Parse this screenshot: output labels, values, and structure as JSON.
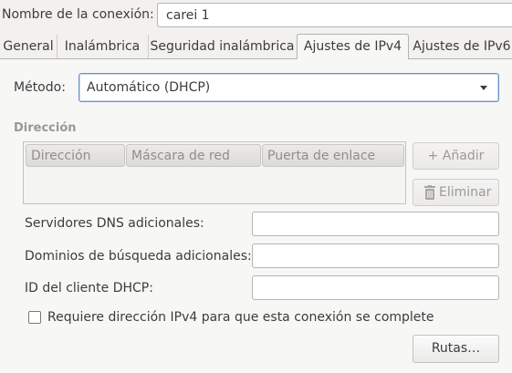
{
  "connection": {
    "name_label": "Nombre de la conexión:",
    "name_value": "carei 1"
  },
  "tabs": [
    {
      "label": "General"
    },
    {
      "label": "Inalámbrica"
    },
    {
      "label": "Seguridad inalámbrica"
    },
    {
      "label": "Ajustes de IPv4"
    },
    {
      "label": "Ajustes de IPv6"
    }
  ],
  "active_tab": "Ajustes de IPv4",
  "method": {
    "label": "Método:",
    "value": "Automático (DHCP)"
  },
  "address_section": {
    "title": "Dirección",
    "columns": [
      "Dirección",
      "Máscara de red",
      "Puerta de enlace"
    ],
    "add_label": "+ Añadir",
    "delete_label": "Eliminar"
  },
  "fields": {
    "dns_label": "Servidores DNS adicionales:",
    "dns_value": "",
    "search_label": "Dominios de búsqueda adicionales:",
    "search_value": "",
    "dhcp_label": "ID del cliente DHCP:",
    "dhcp_value": ""
  },
  "require_ipv4": {
    "label": "Requiere dirección IPv4 para que esta conexión se complete",
    "checked": false
  },
  "routes_label": "Rutas…"
}
